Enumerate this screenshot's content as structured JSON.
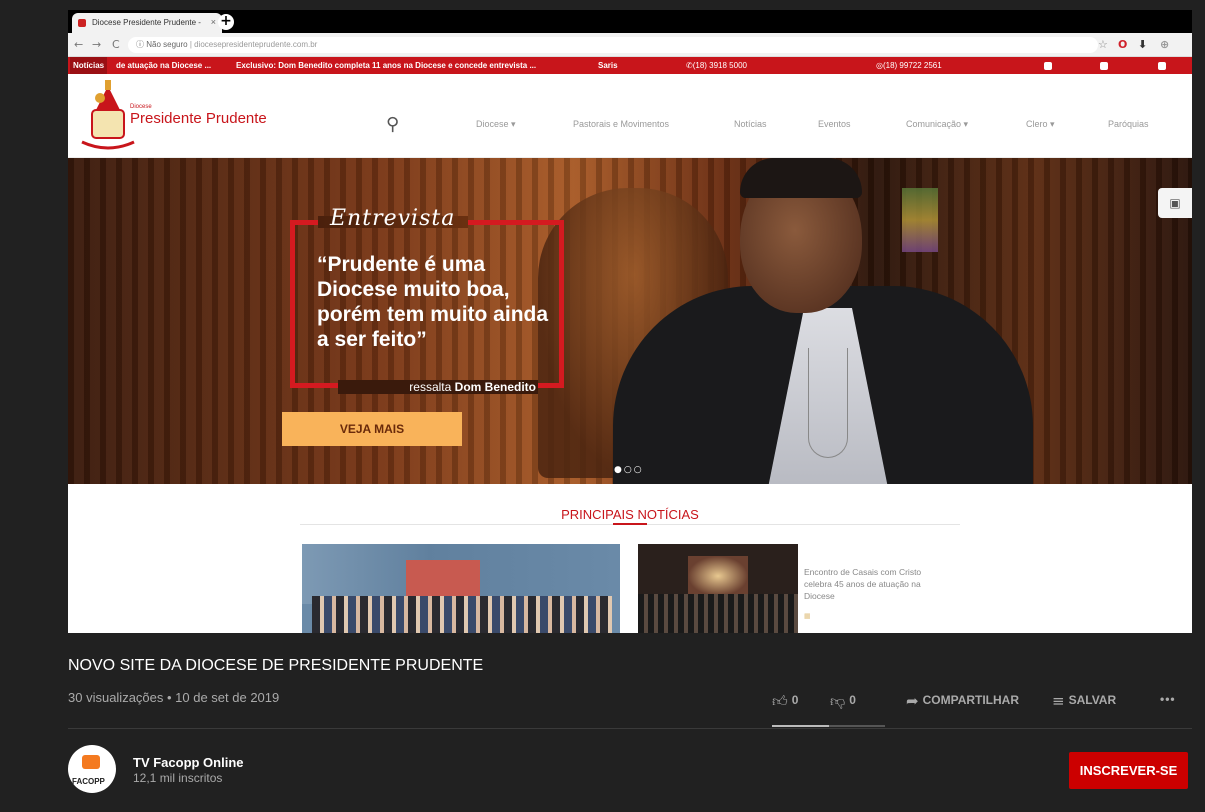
{
  "browser": {
    "tab_title": "Diocese Presidente Prudente - ",
    "tab_close": "×",
    "new_tab": "+",
    "nav_back": "←",
    "nav_forward": "→",
    "nav_reload": "C",
    "url_security": "ⓘ Não seguro",
    "url": "diocesepresidenteprudente.com.br"
  },
  "ticker": {
    "label": "Notícias",
    "headline_1": "de atuação na Diocese ...",
    "headline_2": "Exclusivo: Dom Benedito completa 11 anos na Diocese e concede entrevista ...",
    "headline_3": "Saris",
    "phone": "(18) 3918 5000",
    "whatsapp": "(18) 99722 2561"
  },
  "site": {
    "logo_small": "Diocese",
    "logo_name": "Presidente Prudente",
    "menu": [
      "Diocese ▾",
      "Pastorais e Movimentos",
      "Notícias",
      "Eventos",
      "Comunicação ▾",
      "Clero ▾",
      "Paróquias"
    ]
  },
  "hero": {
    "kicker": "Entrevista",
    "quote": "“Prudente é uma Diocese muito boa, porém tem muito ainda a ser feito”",
    "attribution_prefix": "ressalta",
    "attribution_name": "Dom Benedito",
    "cta": "VEJA MAIS",
    "dots": "●○○"
  },
  "news": {
    "section_title": "PRINCIPAIS NOTÍCIAS",
    "item2_title": "Encontro de Casais com Cristo celebra 45 anos de atuação na Diocese"
  },
  "video": {
    "title": "NOVO SITE DA DIOCESE DE PRESIDENTE PRUDENTE",
    "meta": "30 visualizações • 10 de set de 2019",
    "likes": "0",
    "dislikes": "0",
    "share_label": "COMPARTILHAR",
    "save_label": "SALVAR",
    "more": "•••"
  },
  "channel": {
    "avatar_text": "FACOPP",
    "name": "TV Facopp Online",
    "subscribers": "12,1 mil inscritos",
    "subscribe_label": "INSCREVER-SE"
  },
  "colors": {
    "site_red": "#c8151b",
    "cta_orange": "#f9b35a",
    "youtube_red": "#cc0000",
    "page_bg": "#212121"
  },
  "icons": {
    "search": "search-icon",
    "like": "thumbs-up-icon",
    "dislike": "thumbs-down-icon",
    "share": "share-arrow-icon",
    "save": "playlist-add-icon",
    "camera": "camera-icon"
  }
}
